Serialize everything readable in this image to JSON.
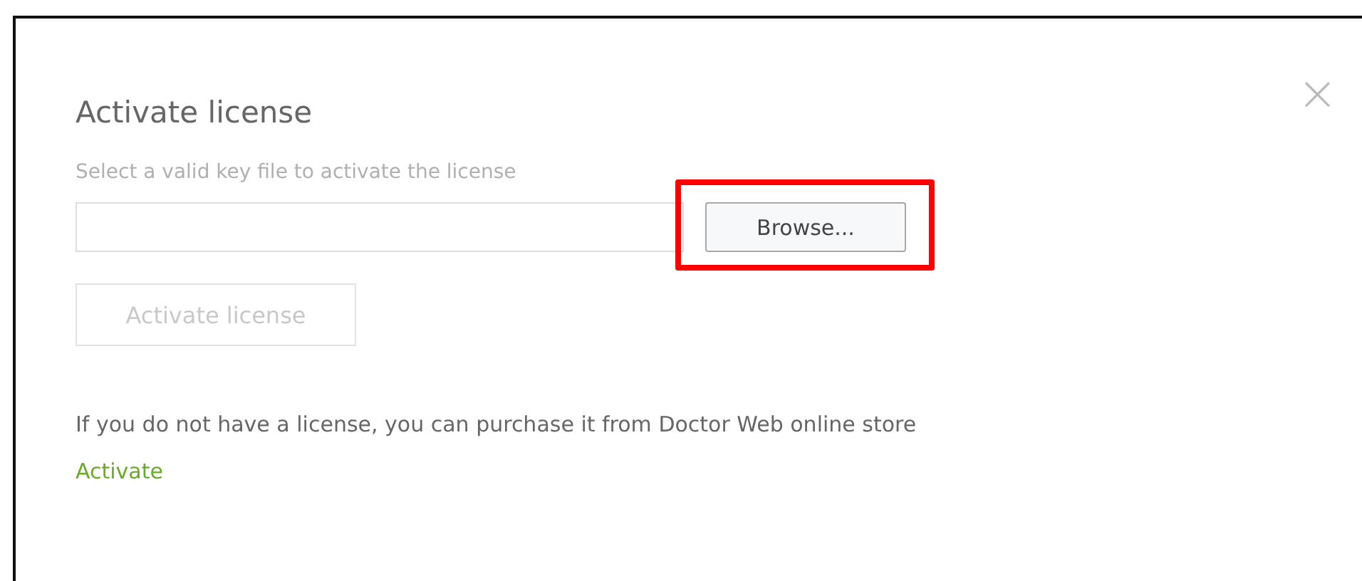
{
  "dialog": {
    "title": "Activate license",
    "close": "×"
  },
  "key_file": {
    "hint": "Select a valid key file to activate the license"
  },
  "browse_button": {
    "label": "Browse...",
    "highlighted": true
  },
  "activate_button": {
    "label": "Activate license",
    "disabled": true
  },
  "purchase_text": "If you do not have a license, you can purchase it from Doctor Web online store",
  "activate_link": "Activate"
}
